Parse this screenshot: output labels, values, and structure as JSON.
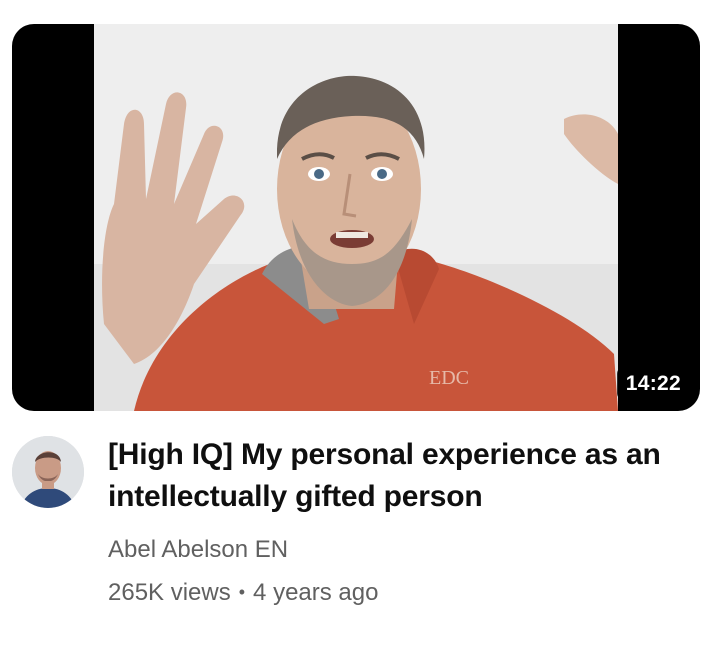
{
  "video": {
    "title": "[High IQ] My personal experience as an intellectually gifted person",
    "duration": "14:22",
    "channel": "Abel Abelson EN",
    "views": "265K views",
    "separator": "•",
    "age": "4 years ago",
    "shirt_text": "EDC"
  },
  "colors": {
    "title": "#0f0f0f",
    "secondary": "#606060",
    "duration_bg": "#000000",
    "hoodie": "#c8553a"
  }
}
